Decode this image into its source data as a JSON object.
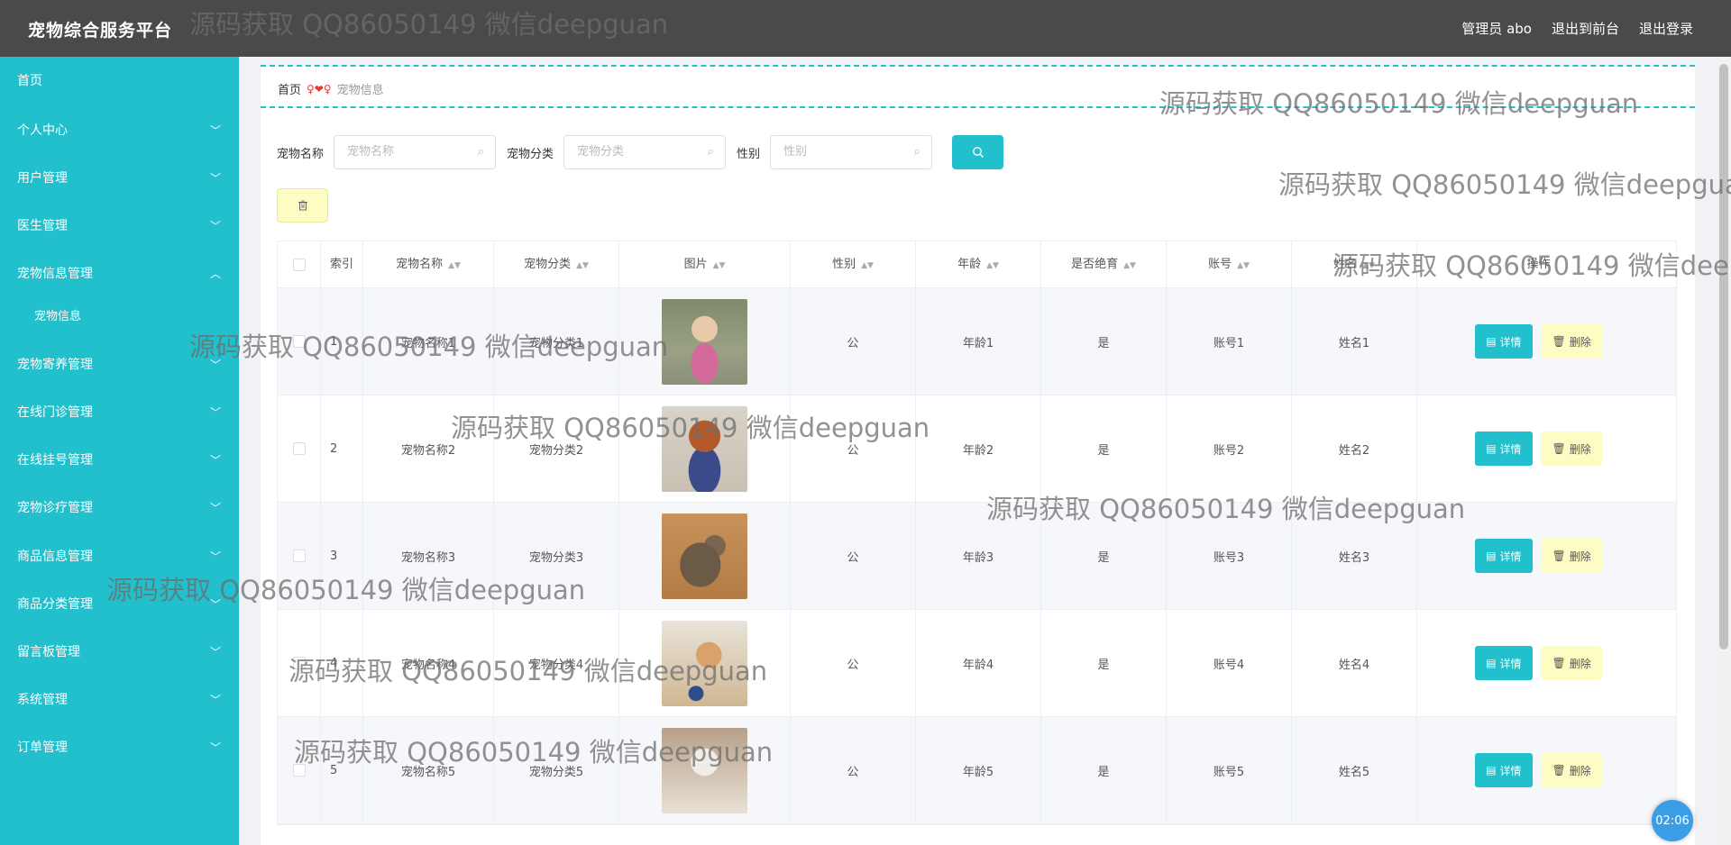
{
  "app": {
    "title": "宠物综合服务平台",
    "topnav": [
      "管理员 abo",
      "退出到前台",
      "退出登录"
    ]
  },
  "sidebar": {
    "items": [
      {
        "label": "首页",
        "expandable": false
      },
      {
        "label": "个人中心",
        "expandable": true
      },
      {
        "label": "用户管理",
        "expandable": true
      },
      {
        "label": "医生管理",
        "expandable": true
      },
      {
        "label": "宠物信息管理",
        "expandable": true,
        "expanded": true
      },
      {
        "label": "宠物信息",
        "sub": true
      },
      {
        "label": "宠物寄养管理",
        "expandable": true
      },
      {
        "label": "在线门诊管理",
        "expandable": true
      },
      {
        "label": "在线挂号管理",
        "expandable": true
      },
      {
        "label": "宠物诊疗管理",
        "expandable": true
      },
      {
        "label": "商品信息管理",
        "expandable": true
      },
      {
        "label": "商品分类管理",
        "expandable": true
      },
      {
        "label": "留言板管理",
        "expandable": true
      },
      {
        "label": "系统管理",
        "expandable": true
      },
      {
        "label": "订单管理",
        "expandable": true
      }
    ]
  },
  "breadcrumb": {
    "home": "首页",
    "separator": "♀❤♀",
    "current": "宠物信息"
  },
  "search": {
    "fields": [
      {
        "label": "宠物名称",
        "placeholder": "宠物名称"
      },
      {
        "label": "宠物分类",
        "placeholder": "宠物分类"
      },
      {
        "label": "性别",
        "placeholder": "性别"
      }
    ]
  },
  "table": {
    "headers": [
      "",
      "索引",
      "宠物名称",
      "宠物分类",
      "图片",
      "性别",
      "年龄",
      "是否绝育",
      "账号",
      "姓名",
      "操作"
    ],
    "rows": [
      {
        "index": "1",
        "name": "宠物名称1",
        "category": "宠物分类1",
        "gender": "公",
        "age": "年龄1",
        "neutered": "是",
        "account": "账号1",
        "owner": "姓名1"
      },
      {
        "index": "2",
        "name": "宠物名称2",
        "category": "宠物分类2",
        "gender": "公",
        "age": "年龄2",
        "neutered": "是",
        "account": "账号2",
        "owner": "姓名2"
      },
      {
        "index": "3",
        "name": "宠物名称3",
        "category": "宠物分类3",
        "gender": "公",
        "age": "年龄3",
        "neutered": "是",
        "account": "账号3",
        "owner": "姓名3"
      },
      {
        "index": "4",
        "name": "宠物名称4",
        "category": "宠物分类4",
        "gender": "公",
        "age": "年龄4",
        "neutered": "是",
        "account": "账号4",
        "owner": "姓名4"
      },
      {
        "index": "5",
        "name": "宠物名称5",
        "category": "宠物分类5",
        "gender": "公",
        "age": "年龄5",
        "neutered": "是",
        "account": "账号5",
        "owner": "姓名5"
      }
    ],
    "detail_label": "详情",
    "delete_label": "删除"
  },
  "timer": "02:06",
  "watermark": "源码获取 QQ86050149 微信deepguan",
  "colors": {
    "accent": "#22bfcc",
    "topbar": "#4a4a4a",
    "warn_btn": "#fdfdc3"
  }
}
